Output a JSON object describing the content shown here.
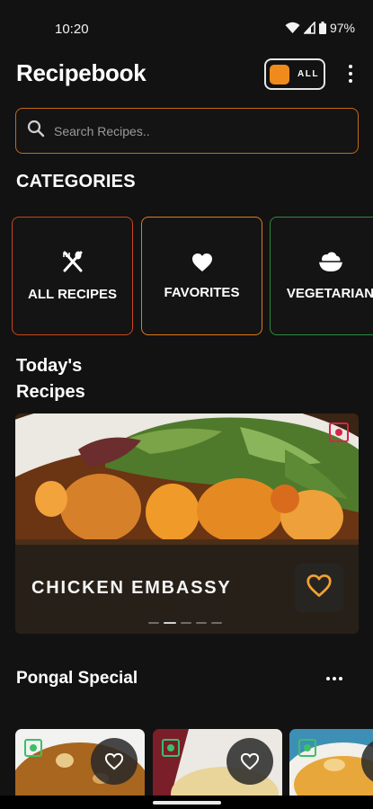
{
  "status_bar": {
    "time": "10:20",
    "battery": "97%",
    "icons": [
      "wifi-icon",
      "signal-icon",
      "battery-icon"
    ]
  },
  "header": {
    "title": "Recipebook",
    "filter_toggle": {
      "label": "ALL",
      "accent": "#f08a1c"
    }
  },
  "search": {
    "placeholder": "Search Recipes..",
    "value": ""
  },
  "categories": {
    "title": "CATEGORIES",
    "items": [
      {
        "label": "ALL RECIPES",
        "icon": "utensils-icon",
        "border": "#c9451f"
      },
      {
        "label": "FAVORITES",
        "icon": "heart-icon",
        "border": "#e07a1b"
      },
      {
        "label": "VEGETARIAN",
        "icon": "salad-bowl-icon",
        "border": "#2e8b3a"
      }
    ]
  },
  "today": {
    "title": "Today's Recipes",
    "featured": {
      "name": "CHICKEN EMBASSY",
      "diet": "non-veg",
      "slides": 5,
      "active_slide": 1
    }
  },
  "pongal": {
    "title": "Pongal Special",
    "cards": [
      {
        "diet": "veg",
        "icon": "heart-outline-icon"
      },
      {
        "diet": "veg",
        "icon": "heart-outline-icon"
      },
      {
        "diet": "veg",
        "icon": "heart-outline-icon"
      }
    ]
  },
  "colors": {
    "background": "#121212",
    "accent": "#f08a1c",
    "veg": "#3cbf6a",
    "non_veg": "#d8234a"
  }
}
